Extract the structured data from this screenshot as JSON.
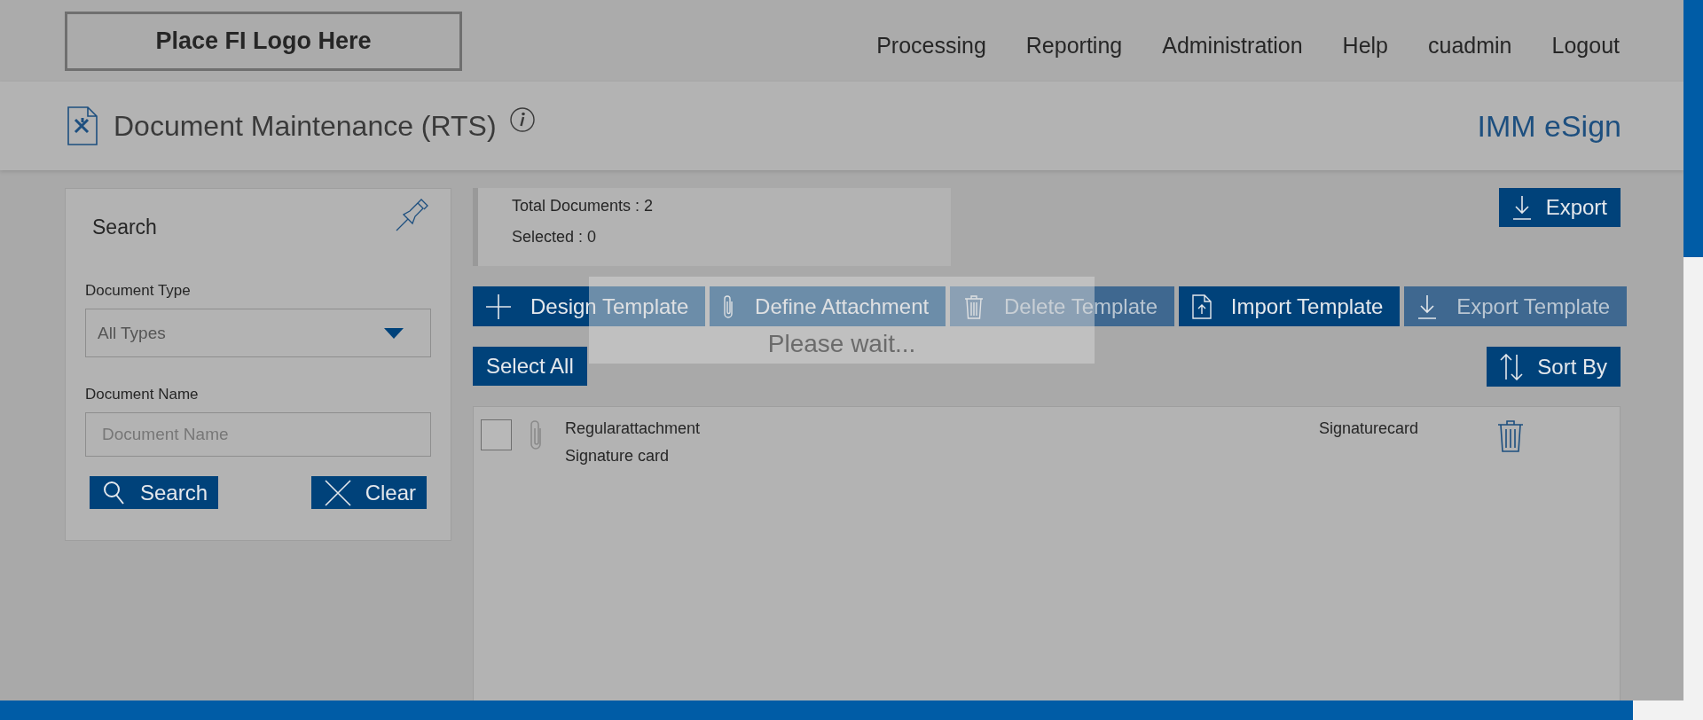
{
  "header": {
    "logo": "Place FI Logo Here",
    "nav": [
      "Processing",
      "Reporting",
      "Administration",
      "Help",
      "cuadmin",
      "Logout"
    ]
  },
  "title_bar": {
    "title": "Document Maintenance (RTS)",
    "product": "IMM eSign"
  },
  "search_panel": {
    "title": "Search",
    "fields": [
      {
        "label": "Document Type",
        "kind": "select",
        "value": "All Types"
      },
      {
        "label": "Document Name",
        "kind": "text",
        "placeholder": "Document Name"
      }
    ],
    "buttons": [
      {
        "label": "Search",
        "kind": "search"
      },
      {
        "label": "Clear",
        "kind": "clear"
      }
    ]
  },
  "summary": [
    "Total Documents : 2",
    "Selected : 0"
  ],
  "export_button": "Export",
  "toolbar": [
    {
      "label": "Design Template",
      "kind": "design",
      "disabled": false
    },
    {
      "label": "Define Attachment",
      "kind": "attach",
      "disabled": false
    },
    {
      "label": "Delete Template",
      "kind": "delete",
      "disabled": true
    },
    {
      "label": "Import Template",
      "kind": "import",
      "disabled": false
    },
    {
      "label": "Export Template",
      "kind": "export",
      "disabled": true
    }
  ],
  "select_all": "Select All",
  "sort_by": "Sort By",
  "documents": [
    {
      "name": "Regularattachment",
      "description": "Signature card",
      "type": "Signaturecard",
      "checked": false
    }
  ],
  "loading": {
    "message": "Please wait..."
  }
}
